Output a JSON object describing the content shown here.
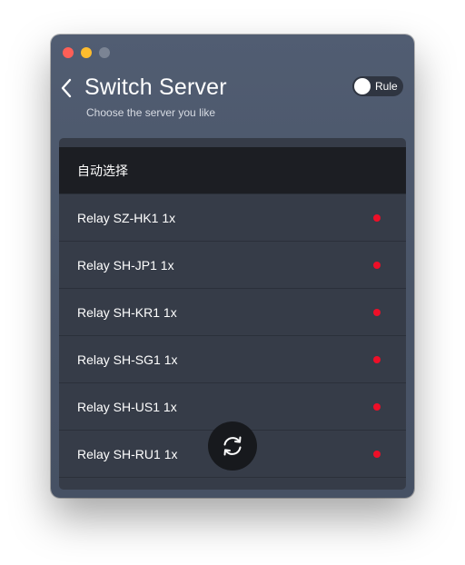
{
  "window": {
    "title": "Switch Server",
    "subtitle": "Choose the server you like"
  },
  "rule_toggle": {
    "label": "Rule",
    "state": "off"
  },
  "icons": {
    "back": "chevron-left-icon",
    "refresh": "refresh-icon"
  },
  "servers": [
    {
      "label": "自动选择",
      "selected": true,
      "status": null
    },
    {
      "label": "Relay SZ-HK1 1x",
      "selected": false,
      "status": "offline"
    },
    {
      "label": "Relay SH-JP1 1x",
      "selected": false,
      "status": "offline"
    },
    {
      "label": "Relay SH-KR1 1x",
      "selected": false,
      "status": "offline"
    },
    {
      "label": "Relay SH-SG1 1x",
      "selected": false,
      "status": "offline"
    },
    {
      "label": "Relay SH-US1 1x",
      "selected": false,
      "status": "offline"
    },
    {
      "label": "Relay SH-RU1 1x",
      "selected": false,
      "status": "offline"
    }
  ],
  "colors": {
    "status_offline": "#ee0f28",
    "selected_row": "#1c1e23",
    "window_bg": "#4a5568"
  }
}
